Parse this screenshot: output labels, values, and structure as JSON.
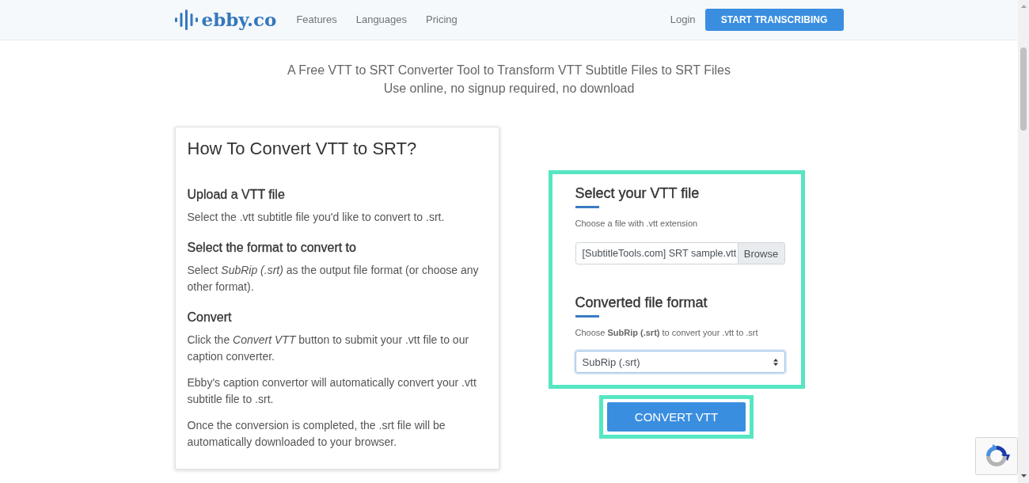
{
  "header": {
    "logo": "ebby.co",
    "nav": [
      "Features",
      "Languages",
      "Pricing"
    ],
    "login": "Login",
    "cta": "START TRANSCRIBING"
  },
  "intro": [
    "A Free VTT to SRT Converter Tool to Transform VTT Subtitle Files to SRT Files",
    "Use online, no signup required, no download"
  ],
  "guide": {
    "title": "How To Convert VTT to SRT?",
    "sections": [
      {
        "heading": "Upload a VTT file",
        "paragraphs": [
          "Select the .vtt subtitle file you'd like to convert to .srt."
        ]
      },
      {
        "heading": "Select the format to convert to",
        "paragraphs": [
          "Select *SubRip (.srt)* as the output file format (or choose any other format)."
        ]
      },
      {
        "heading": "Convert",
        "paragraphs": [
          "Click the *Convert VTT* button to submit your .vtt file to our caption converter.",
          "Ebby's caption convertor will automatically convert your .vtt subtitle file to .srt.",
          "Once the conversion is completed, the .srt file will be automatically downloaded to your browser."
        ]
      }
    ]
  },
  "converter": {
    "highlighted": true,
    "file_step": {
      "title": "Select your VTT file",
      "hint": "Choose a file with .vtt extension",
      "file_name": "[SubtitleTools.com] SRT sample.vtt",
      "browse": "Browse"
    },
    "format_step": {
      "title": "Converted file format",
      "hint": "Choose **SubRip (.srt)** to convert your .vtt to .srt",
      "value": "SubRip (.srt)",
      "focused": true
    },
    "convert_button": {
      "label": "CONVERT VTT",
      "highlighted": true
    }
  }
}
